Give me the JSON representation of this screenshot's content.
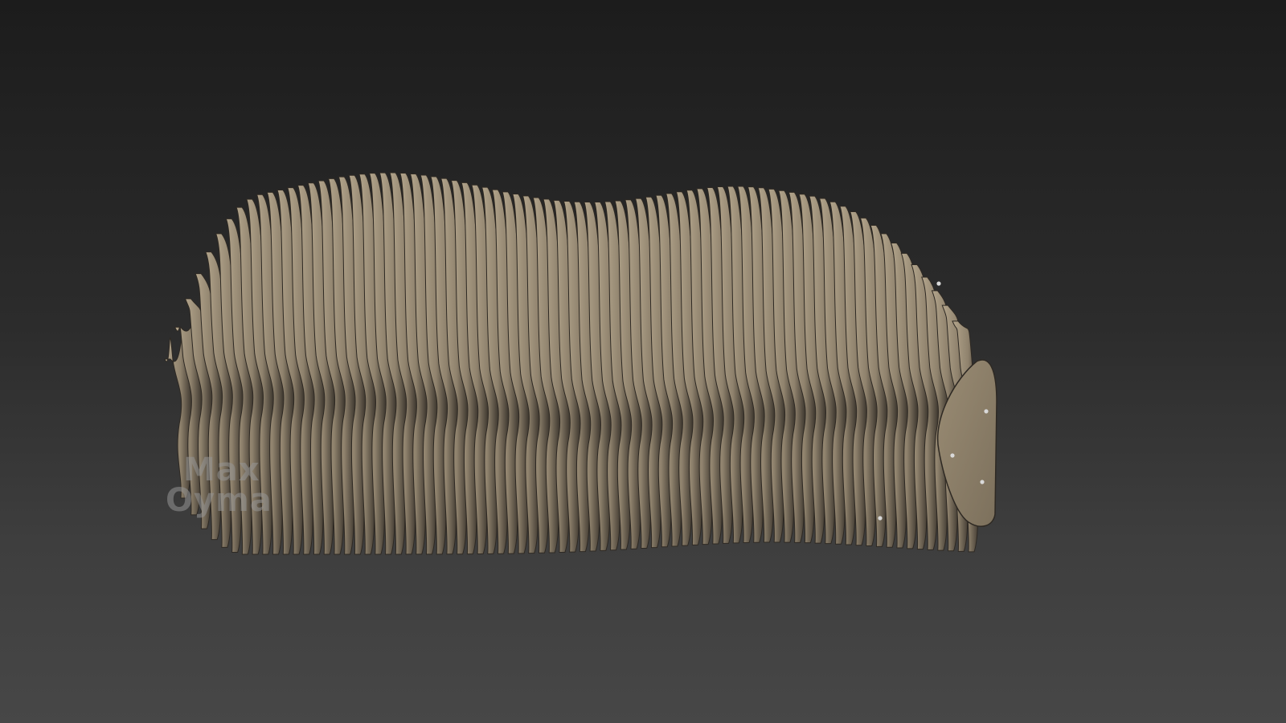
{
  "scene": {
    "subject": "parametric-slat-bench",
    "background_color_top": "#1c1c1c",
    "background_color_bottom": "#474747",
    "slat_color": "#8f826d",
    "slat_highlight_color": "#b3a58c",
    "slat_shadow_color": "#2e2923",
    "end_panel_color": "#8a7d67",
    "fastener_color": "#d9d9d9"
  },
  "watermark": {
    "line1": "Max",
    "line2": "Oyma"
  }
}
